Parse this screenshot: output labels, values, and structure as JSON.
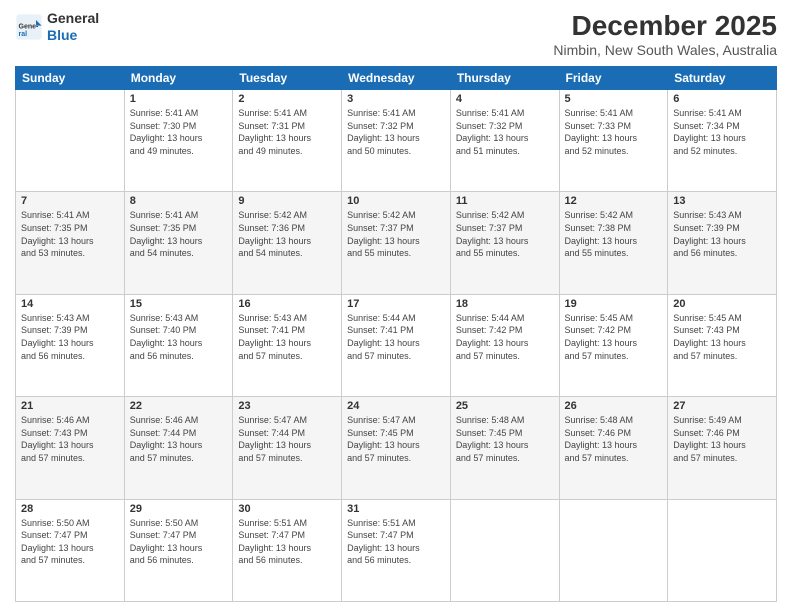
{
  "header": {
    "logo": {
      "general": "General",
      "blue": "Blue"
    },
    "title": "December 2025",
    "location": "Nimbin, New South Wales, Australia"
  },
  "weekdays": [
    "Sunday",
    "Monday",
    "Tuesday",
    "Wednesday",
    "Thursday",
    "Friday",
    "Saturday"
  ],
  "weeks": [
    [
      {
        "day": "",
        "info": ""
      },
      {
        "day": "1",
        "info": "Sunrise: 5:41 AM\nSunset: 7:30 PM\nDaylight: 13 hours\nand 49 minutes."
      },
      {
        "day": "2",
        "info": "Sunrise: 5:41 AM\nSunset: 7:31 PM\nDaylight: 13 hours\nand 49 minutes."
      },
      {
        "day": "3",
        "info": "Sunrise: 5:41 AM\nSunset: 7:32 PM\nDaylight: 13 hours\nand 50 minutes."
      },
      {
        "day": "4",
        "info": "Sunrise: 5:41 AM\nSunset: 7:32 PM\nDaylight: 13 hours\nand 51 minutes."
      },
      {
        "day": "5",
        "info": "Sunrise: 5:41 AM\nSunset: 7:33 PM\nDaylight: 13 hours\nand 52 minutes."
      },
      {
        "day": "6",
        "info": "Sunrise: 5:41 AM\nSunset: 7:34 PM\nDaylight: 13 hours\nand 52 minutes."
      }
    ],
    [
      {
        "day": "7",
        "info": "Sunrise: 5:41 AM\nSunset: 7:35 PM\nDaylight: 13 hours\nand 53 minutes."
      },
      {
        "day": "8",
        "info": "Sunrise: 5:41 AM\nSunset: 7:35 PM\nDaylight: 13 hours\nand 54 minutes."
      },
      {
        "day": "9",
        "info": "Sunrise: 5:42 AM\nSunset: 7:36 PM\nDaylight: 13 hours\nand 54 minutes."
      },
      {
        "day": "10",
        "info": "Sunrise: 5:42 AM\nSunset: 7:37 PM\nDaylight: 13 hours\nand 55 minutes."
      },
      {
        "day": "11",
        "info": "Sunrise: 5:42 AM\nSunset: 7:37 PM\nDaylight: 13 hours\nand 55 minutes."
      },
      {
        "day": "12",
        "info": "Sunrise: 5:42 AM\nSunset: 7:38 PM\nDaylight: 13 hours\nand 55 minutes."
      },
      {
        "day": "13",
        "info": "Sunrise: 5:43 AM\nSunset: 7:39 PM\nDaylight: 13 hours\nand 56 minutes."
      }
    ],
    [
      {
        "day": "14",
        "info": "Sunrise: 5:43 AM\nSunset: 7:39 PM\nDaylight: 13 hours\nand 56 minutes."
      },
      {
        "day": "15",
        "info": "Sunrise: 5:43 AM\nSunset: 7:40 PM\nDaylight: 13 hours\nand 56 minutes."
      },
      {
        "day": "16",
        "info": "Sunrise: 5:43 AM\nSunset: 7:41 PM\nDaylight: 13 hours\nand 57 minutes."
      },
      {
        "day": "17",
        "info": "Sunrise: 5:44 AM\nSunset: 7:41 PM\nDaylight: 13 hours\nand 57 minutes."
      },
      {
        "day": "18",
        "info": "Sunrise: 5:44 AM\nSunset: 7:42 PM\nDaylight: 13 hours\nand 57 minutes."
      },
      {
        "day": "19",
        "info": "Sunrise: 5:45 AM\nSunset: 7:42 PM\nDaylight: 13 hours\nand 57 minutes."
      },
      {
        "day": "20",
        "info": "Sunrise: 5:45 AM\nSunset: 7:43 PM\nDaylight: 13 hours\nand 57 minutes."
      }
    ],
    [
      {
        "day": "21",
        "info": "Sunrise: 5:46 AM\nSunset: 7:43 PM\nDaylight: 13 hours\nand 57 minutes."
      },
      {
        "day": "22",
        "info": "Sunrise: 5:46 AM\nSunset: 7:44 PM\nDaylight: 13 hours\nand 57 minutes."
      },
      {
        "day": "23",
        "info": "Sunrise: 5:47 AM\nSunset: 7:44 PM\nDaylight: 13 hours\nand 57 minutes."
      },
      {
        "day": "24",
        "info": "Sunrise: 5:47 AM\nSunset: 7:45 PM\nDaylight: 13 hours\nand 57 minutes."
      },
      {
        "day": "25",
        "info": "Sunrise: 5:48 AM\nSunset: 7:45 PM\nDaylight: 13 hours\nand 57 minutes."
      },
      {
        "day": "26",
        "info": "Sunrise: 5:48 AM\nSunset: 7:46 PM\nDaylight: 13 hours\nand 57 minutes."
      },
      {
        "day": "27",
        "info": "Sunrise: 5:49 AM\nSunset: 7:46 PM\nDaylight: 13 hours\nand 57 minutes."
      }
    ],
    [
      {
        "day": "28",
        "info": "Sunrise: 5:50 AM\nSunset: 7:47 PM\nDaylight: 13 hours\nand 57 minutes."
      },
      {
        "day": "29",
        "info": "Sunrise: 5:50 AM\nSunset: 7:47 PM\nDaylight: 13 hours\nand 56 minutes."
      },
      {
        "day": "30",
        "info": "Sunrise: 5:51 AM\nSunset: 7:47 PM\nDaylight: 13 hours\nand 56 minutes."
      },
      {
        "day": "31",
        "info": "Sunrise: 5:51 AM\nSunset: 7:47 PM\nDaylight: 13 hours\nand 56 minutes."
      },
      {
        "day": "",
        "info": ""
      },
      {
        "day": "",
        "info": ""
      },
      {
        "day": "",
        "info": ""
      }
    ]
  ]
}
